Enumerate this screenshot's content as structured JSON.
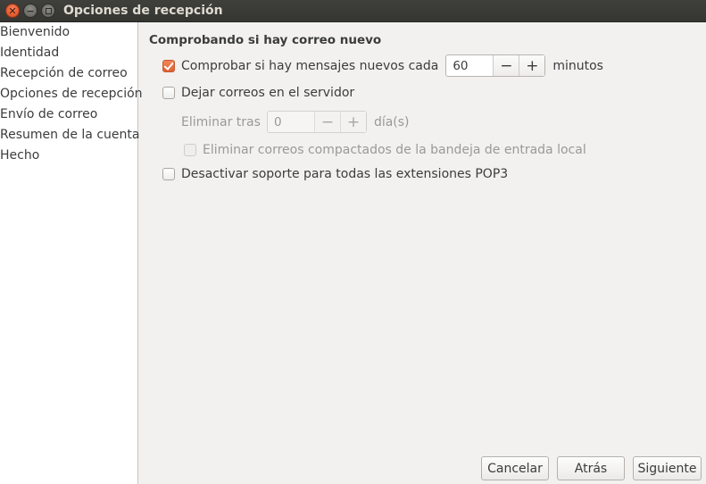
{
  "window": {
    "title": "Opciones de recepción"
  },
  "sidebar": {
    "items": [
      {
        "label": "Bienvenido"
      },
      {
        "label": "Identidad"
      },
      {
        "label": "Recepción de correo"
      },
      {
        "label": "Opciones de recepción"
      },
      {
        "label": "Envío de correo"
      },
      {
        "label": "Resumen de la cuenta"
      },
      {
        "label": "Hecho"
      }
    ]
  },
  "main": {
    "section_title": "Comprobando si hay correo nuevo",
    "check_new": {
      "label": "Comprobar si hay mensajes nuevos cada",
      "checked": true,
      "value": "60",
      "unit": "minutos"
    },
    "leave_on_server": {
      "label": "Dejar correos en el servidor",
      "checked": false
    },
    "delete_after": {
      "label": "Eliminar tras",
      "value": "0",
      "unit": "día(s)",
      "enabled": false
    },
    "delete_compacted": {
      "label": "Eliminar correos compactados de la bandeja de entrada local",
      "checked": false,
      "enabled": false
    },
    "disable_pop3": {
      "label": "Desactivar soporte para todas las extensiones POP3",
      "checked": false
    }
  },
  "spin_buttons": {
    "minus": "−",
    "plus": "+"
  },
  "footer": {
    "cancel_label": "Cancelar",
    "back_label": "Atrás",
    "next_label": "Siguiente"
  },
  "colors": {
    "accent": "#e05f2e",
    "titlebar": "#3c3b37"
  }
}
